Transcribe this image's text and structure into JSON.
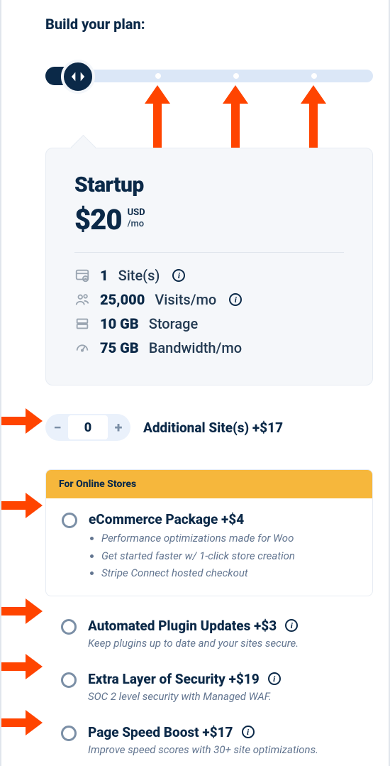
{
  "title": "Build your plan:",
  "plan": {
    "name": "Startup",
    "price": "$20",
    "currency": "USD",
    "period": "/mo",
    "stats": {
      "sites_value": "1",
      "sites_unit": "Site(s)",
      "visits_value": "25,000",
      "visits_unit": "Visits/mo",
      "storage_value": "10 GB",
      "storage_unit": "Storage",
      "bandwidth_value": "75 GB",
      "bandwidth_unit": "Bandwidth/mo"
    }
  },
  "additional_sites": {
    "value": "0",
    "label": "Additional Site(s) +$17"
  },
  "ecommerce": {
    "banner": "For Online Stores",
    "title": "eCommerce Package +$4",
    "bullets": [
      "Performance optimizations made for Woo",
      "Get started faster w/ 1-click store creation",
      "Stripe Connect hosted checkout"
    ]
  },
  "addons": [
    {
      "title": "Automated Plugin Updates +$3",
      "desc": "Keep plugins up to date and your sites secure."
    },
    {
      "title": "Extra Layer of Security +$19",
      "desc": "SOC 2 level security with Managed WAF."
    },
    {
      "title": "Page Speed Boost +$17",
      "desc": "Improve speed scores with 30+ site optimizations."
    }
  ],
  "slider": {
    "ticks": 4,
    "position": 0
  }
}
